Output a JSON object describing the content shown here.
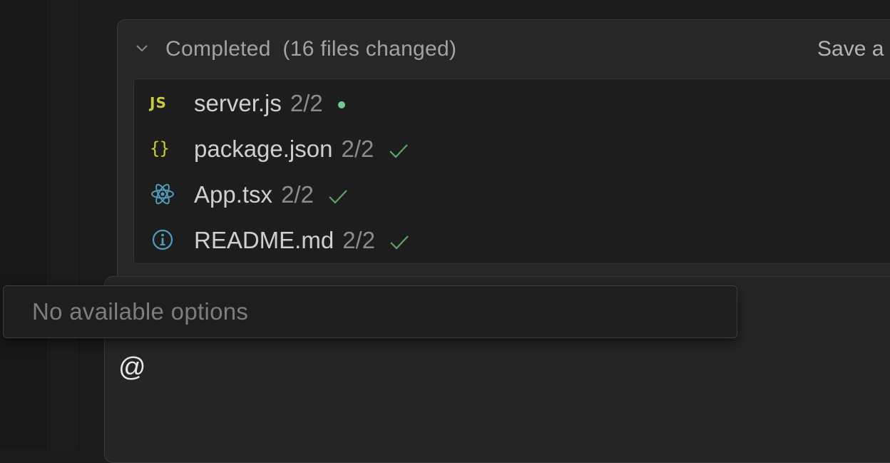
{
  "panel": {
    "status": "Completed",
    "files_changed": "(16 files changed)",
    "save_label": "Save a",
    "files": [
      {
        "icon": "js-icon",
        "icon_text": "JS",
        "name": "server.js",
        "count": "2/2",
        "status": "modified-dot"
      },
      {
        "icon": "json-icon",
        "icon_text": "{}",
        "name": "package.json",
        "count": "2/2",
        "status": "check"
      },
      {
        "icon": "react-icon",
        "name": "App.tsx",
        "count": "2/2",
        "status": "check"
      },
      {
        "icon": "info-icon",
        "name": "README.md",
        "count": "2/2",
        "status": "check"
      }
    ]
  },
  "dropdown": {
    "text": "No available options"
  },
  "chat_input": {
    "value": "@"
  },
  "colors": {
    "js": "#cbcb41",
    "react": "#519aba",
    "check": "#5aa36a",
    "dot": "#73c991"
  }
}
